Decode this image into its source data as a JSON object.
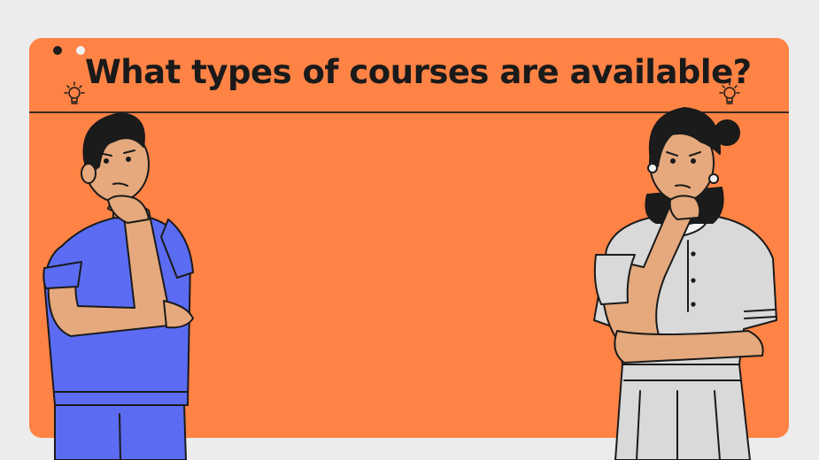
{
  "slide": {
    "title": "What types of courses are available?"
  },
  "colors": {
    "background": "#ececec",
    "card": "#ff8345",
    "text": "#1a1a1a",
    "shirt_left": "#5b6cf3",
    "shirt_right": "#d9d9d9",
    "skin": "#e5a97d",
    "hair": "#1b1b1b"
  },
  "icons": {
    "window_dot_1": "dot",
    "window_dot_2": "dot",
    "bulb_left": "lightbulb-icon",
    "bulb_right": "lightbulb-icon"
  },
  "illustrations": {
    "left": "thinking-man",
    "right": "thinking-woman"
  }
}
